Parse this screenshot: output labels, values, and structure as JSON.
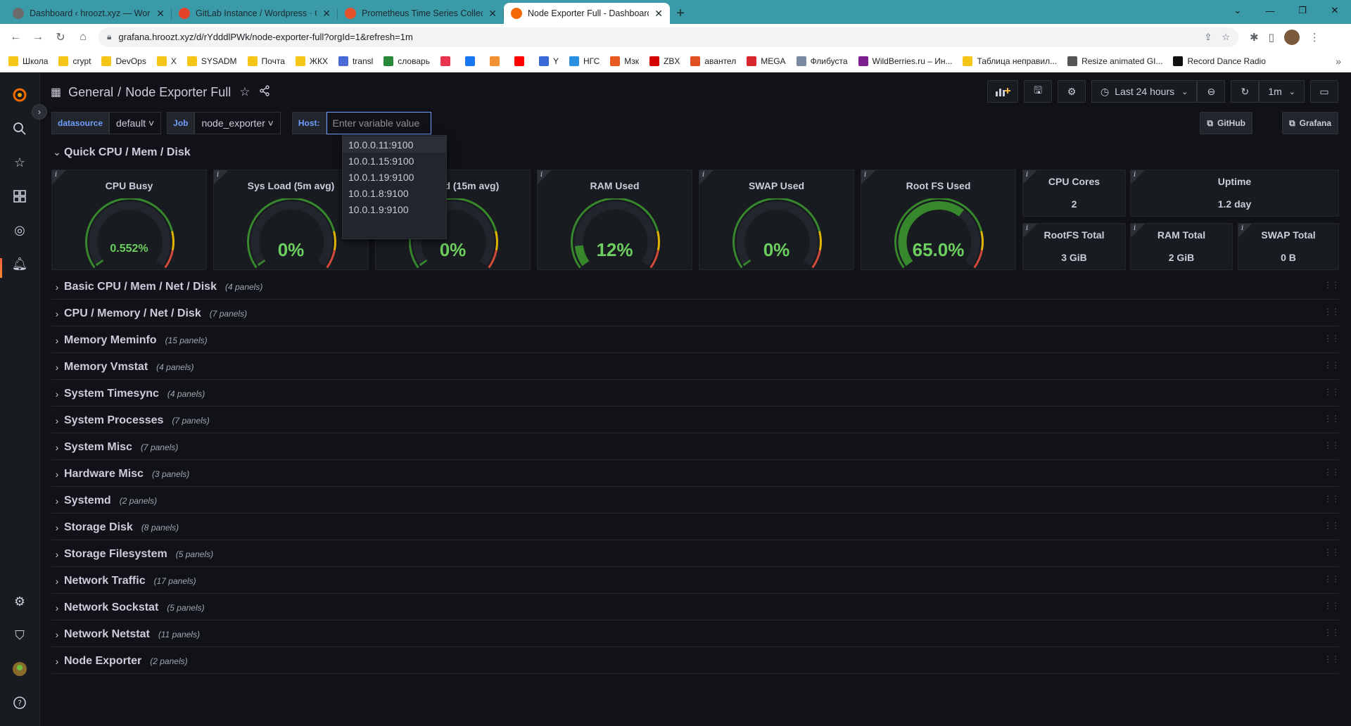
{
  "browser": {
    "tabs": [
      {
        "title": "Dashboard ‹ hroozt.xyz — WordPress",
        "color": "#6b6b6b",
        "active": false
      },
      {
        "title": "GitLab Instance / Wordpress · GitLab",
        "color": "#e24329",
        "active": false
      },
      {
        "title": "Prometheus Time Series Collection",
        "color": "#e6522c",
        "active": false
      },
      {
        "title": "Node Exporter Full - Dashboards",
        "color": "#f46800",
        "active": true
      }
    ],
    "url": "grafana.hroozt.xyz/d/rYdddlPWk/node-exporter-full?orgId=1&refresh=1m",
    "bookmarks": [
      {
        "label": "Школа",
        "color": "#f5c518"
      },
      {
        "label": "crypt",
        "color": "#f5c518"
      },
      {
        "label": "DevOps",
        "color": "#f5c518"
      },
      {
        "label": "X",
        "color": "#f5c518"
      },
      {
        "label": "SYSADM",
        "color": "#f5c518"
      },
      {
        "label": "Почта",
        "color": "#f5c518"
      },
      {
        "label": "ЖКХ",
        "color": "#f5c518"
      },
      {
        "label": "transl",
        "color": "#4a6ad8"
      },
      {
        "label": "словарь",
        "color": "#2a8a3a"
      },
      {
        "label": "",
        "color": "#e8344e"
      },
      {
        "label": "",
        "color": "#1877f2"
      },
      {
        "label": "",
        "color": "#f09030"
      },
      {
        "label": "",
        "color": "#ff0000"
      },
      {
        "label": "Y",
        "color": "#3a6ad8"
      },
      {
        "label": "НГС",
        "color": "#2a90e0"
      },
      {
        "label": "Мзк",
        "color": "#e85a20"
      },
      {
        "label": "ZBX",
        "color": "#d40000"
      },
      {
        "label": "авантел",
        "color": "#e05020"
      },
      {
        "label": "MEGA",
        "color": "#d9272e"
      },
      {
        "label": "Флибуста",
        "color": "#7a8aa0"
      },
      {
        "label": "WildBerries.ru – Ин...",
        "color": "#7d1f8c"
      },
      {
        "label": "Таблица неправил...",
        "color": "#f5c518"
      },
      {
        "label": "Resize animated GI...",
        "color": "#555555"
      },
      {
        "label": "Record Dance Radio",
        "color": "#111111"
      }
    ]
  },
  "grafana": {
    "breadcrumb_folder": "General",
    "breadcrumb_sep": "/",
    "dashboard_title": "Node Exporter Full",
    "time_range": "Last 24 hours",
    "refresh_interval": "1m",
    "variables": [
      {
        "label": "datasource",
        "value": "default ˅"
      },
      {
        "label": "Job",
        "value": "node_exporter ˅"
      }
    ],
    "host_label": "Host:",
    "host_placeholder": "Enter variable value",
    "host_options": [
      "10.0.0.11:9100",
      "10.0.1.15:9100",
      "10.0.1.19:9100",
      "10.0.1.8:9100",
      "10.0.1.9:9100"
    ],
    "links": [
      "GitHub",
      "Grafana"
    ],
    "quick_row_title": "Quick CPU / Mem / Disk",
    "gauges": [
      {
        "title": "CPU Busy",
        "value": "0.552%",
        "fraction": 0.00552,
        "fill": "#37872d"
      },
      {
        "title": "Sys Load (5m avg)",
        "value": "0%",
        "fraction": 0,
        "fill": "#37872d"
      },
      {
        "title": "Sys Load (15m avg)",
        "value": "0%",
        "fraction": 0,
        "fill": "#37872d"
      },
      {
        "title": "RAM Used",
        "value": "12%",
        "fraction": 0.12,
        "fill": "#37872d"
      },
      {
        "title": "SWAP Used",
        "value": "0%",
        "fraction": 0,
        "fill": "#37872d"
      },
      {
        "title": "Root FS Used",
        "value": "65.0%",
        "fraction": 0.65,
        "fill": "#37872d"
      }
    ],
    "stats_top": [
      {
        "title": "CPU Cores",
        "value": "2"
      },
      {
        "title": "Uptime",
        "value": "1.2 day"
      }
    ],
    "stats_bottom": [
      {
        "title": "RootFS Total",
        "value": "3 GiB"
      },
      {
        "title": "RAM Total",
        "value": "2 GiB"
      },
      {
        "title": "SWAP Total",
        "value": "0 B"
      }
    ],
    "rows": [
      {
        "title": "Basic CPU / Mem / Net / Disk",
        "count": "(4 panels)"
      },
      {
        "title": "CPU / Memory / Net / Disk",
        "count": "(7 panels)"
      },
      {
        "title": "Memory Meminfo",
        "count": "(15 panels)"
      },
      {
        "title": "Memory Vmstat",
        "count": "(4 panels)"
      },
      {
        "title": "System Timesync",
        "count": "(4 panels)"
      },
      {
        "title": "System Processes",
        "count": "(7 panels)"
      },
      {
        "title": "System Misc",
        "count": "(7 panels)"
      },
      {
        "title": "Hardware Misc",
        "count": "(3 panels)"
      },
      {
        "title": "Systemd",
        "count": "(2 panels)"
      },
      {
        "title": "Storage Disk",
        "count": "(8 panels)"
      },
      {
        "title": "Storage Filesystem",
        "count": "(5 panels)"
      },
      {
        "title": "Network Traffic",
        "count": "(17 panels)"
      },
      {
        "title": "Network Sockstat",
        "count": "(5 panels)"
      },
      {
        "title": "Network Netstat",
        "count": "(11 panels)"
      },
      {
        "title": "Node Exporter",
        "count": "(2 panels)"
      }
    ]
  }
}
